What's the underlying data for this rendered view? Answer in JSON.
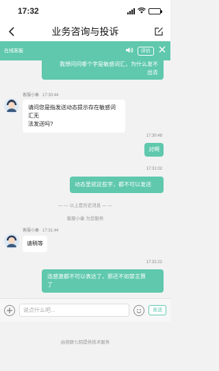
{
  "status_bar": {
    "time": "17:32"
  },
  "nav": {
    "title": "业务咨询与投诉"
  },
  "service_bar": {
    "name": "在线客服",
    "rate_label": "评价"
  },
  "messages": {
    "m1": {
      "text_line1": "我想问问哪个字是敏感词汇，为什么发不",
      "text_line2": "出去"
    },
    "m2": {
      "sender": "客服小秦",
      "time": "17:30:44",
      "text_line1": "请问您是指发送动态提示存在敏感词汇无",
      "text_line2": "法发送吗?"
    },
    "m3": {
      "time": "17:30:48",
      "text": "对啊"
    },
    "m4": {
      "time": "17:31:02",
      "text": "动态里就这些字，都不可以发送"
    },
    "history": "— — 以上是历史消息 — —",
    "service_notice": "客服小秦 为您服务",
    "m5": {
      "sender": "客服小秦",
      "time": "17:31:44",
      "text": "请稍等"
    },
    "m6": {
      "time": "17:32:22",
      "text_line1": "连感激都不可以表达了，那还不如禁言算",
      "text_line2": "了"
    }
  },
  "input_bar": {
    "placeholder": "说点什么吧...",
    "send_label": "发送"
  },
  "footer": {
    "powered_by": "由容联七陌提供技术服务"
  },
  "colors": {
    "accent": "#5fc8ad"
  }
}
